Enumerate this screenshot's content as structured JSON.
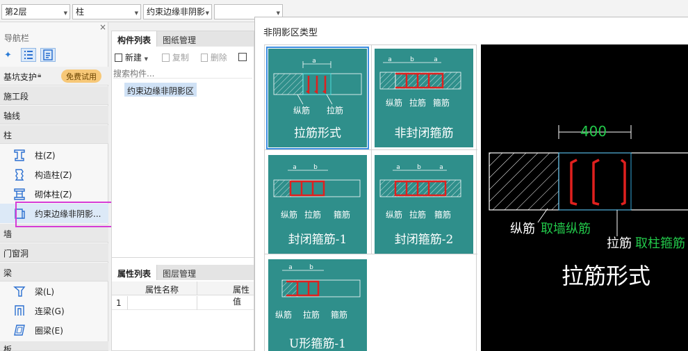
{
  "topbar": {
    "floor": "第2层",
    "category": "柱",
    "component": "约束边缘非阴影",
    "empty_combo": ""
  },
  "nav": {
    "title": "导航栏",
    "close": "×",
    "sections": {
      "foundation_pit": "基坑支护",
      "free_trial": "免费试用",
      "construction_stage": "施工段",
      "axis": "轴线",
      "column": "柱",
      "wall": "墙",
      "door_window": "门窗洞",
      "beam": "梁",
      "slab": "板"
    },
    "column_items": [
      "柱(Z)",
      "构造柱(Z)",
      "砌体柱(Z)",
      "约束边缘非阴影..."
    ],
    "beam_items": [
      "梁(L)",
      "连梁(G)",
      "圈梁(E)"
    ]
  },
  "component_panel": {
    "tab_list": "构件列表",
    "tab_drawing": "图纸管理",
    "new_btn": "新建",
    "copy_btn": "复制",
    "delete_btn": "删除",
    "search_placeholder": "搜索构件...",
    "selected_item": "约束边缘非阴影区"
  },
  "property_panel": {
    "tab_props": "属性列表",
    "tab_layers": "图层管理",
    "col_name": "属性名称",
    "col_value": "属性值",
    "row_index": "1"
  },
  "dialog": {
    "title": "非阴影区类型",
    "cards": [
      {
        "label": "拉筋形式",
        "dims": "a",
        "notes": [
          "纵筋",
          "拉筋"
        ],
        "selected": true
      },
      {
        "label": "非封闭箍筋",
        "dims": "a b a",
        "notes": [
          "纵筋",
          "拉筋",
          "箍筋"
        ],
        "selected": false
      },
      {
        "label": "封闭箍筋-1",
        "dims": "a b",
        "notes": [
          "纵筋",
          "拉筋",
          "箍筋"
        ],
        "selected": false
      },
      {
        "label": "封闭箍筋-2",
        "dims": "a b a",
        "notes": [
          "纵筋",
          "拉筋",
          "箍筋"
        ],
        "selected": false
      },
      {
        "label": "U形箍筋-1",
        "dims": "a b",
        "notes": [
          "纵筋",
          "拉筋",
          "箍筋"
        ],
        "selected": false
      }
    ],
    "preview": {
      "dimension": "400",
      "longitudinal_label": "纵筋",
      "longitudinal_note": "取墙纵筋",
      "tie_label": "拉筋",
      "tie_note": "取柱箍筋",
      "caption": "拉筋形式"
    }
  },
  "colors": {
    "card_bg": "#2f8f8b",
    "selection": "#3a8de0",
    "rebar": "#e0201e",
    "highlight": "#d63cd6",
    "note_green": "#22c84a"
  }
}
